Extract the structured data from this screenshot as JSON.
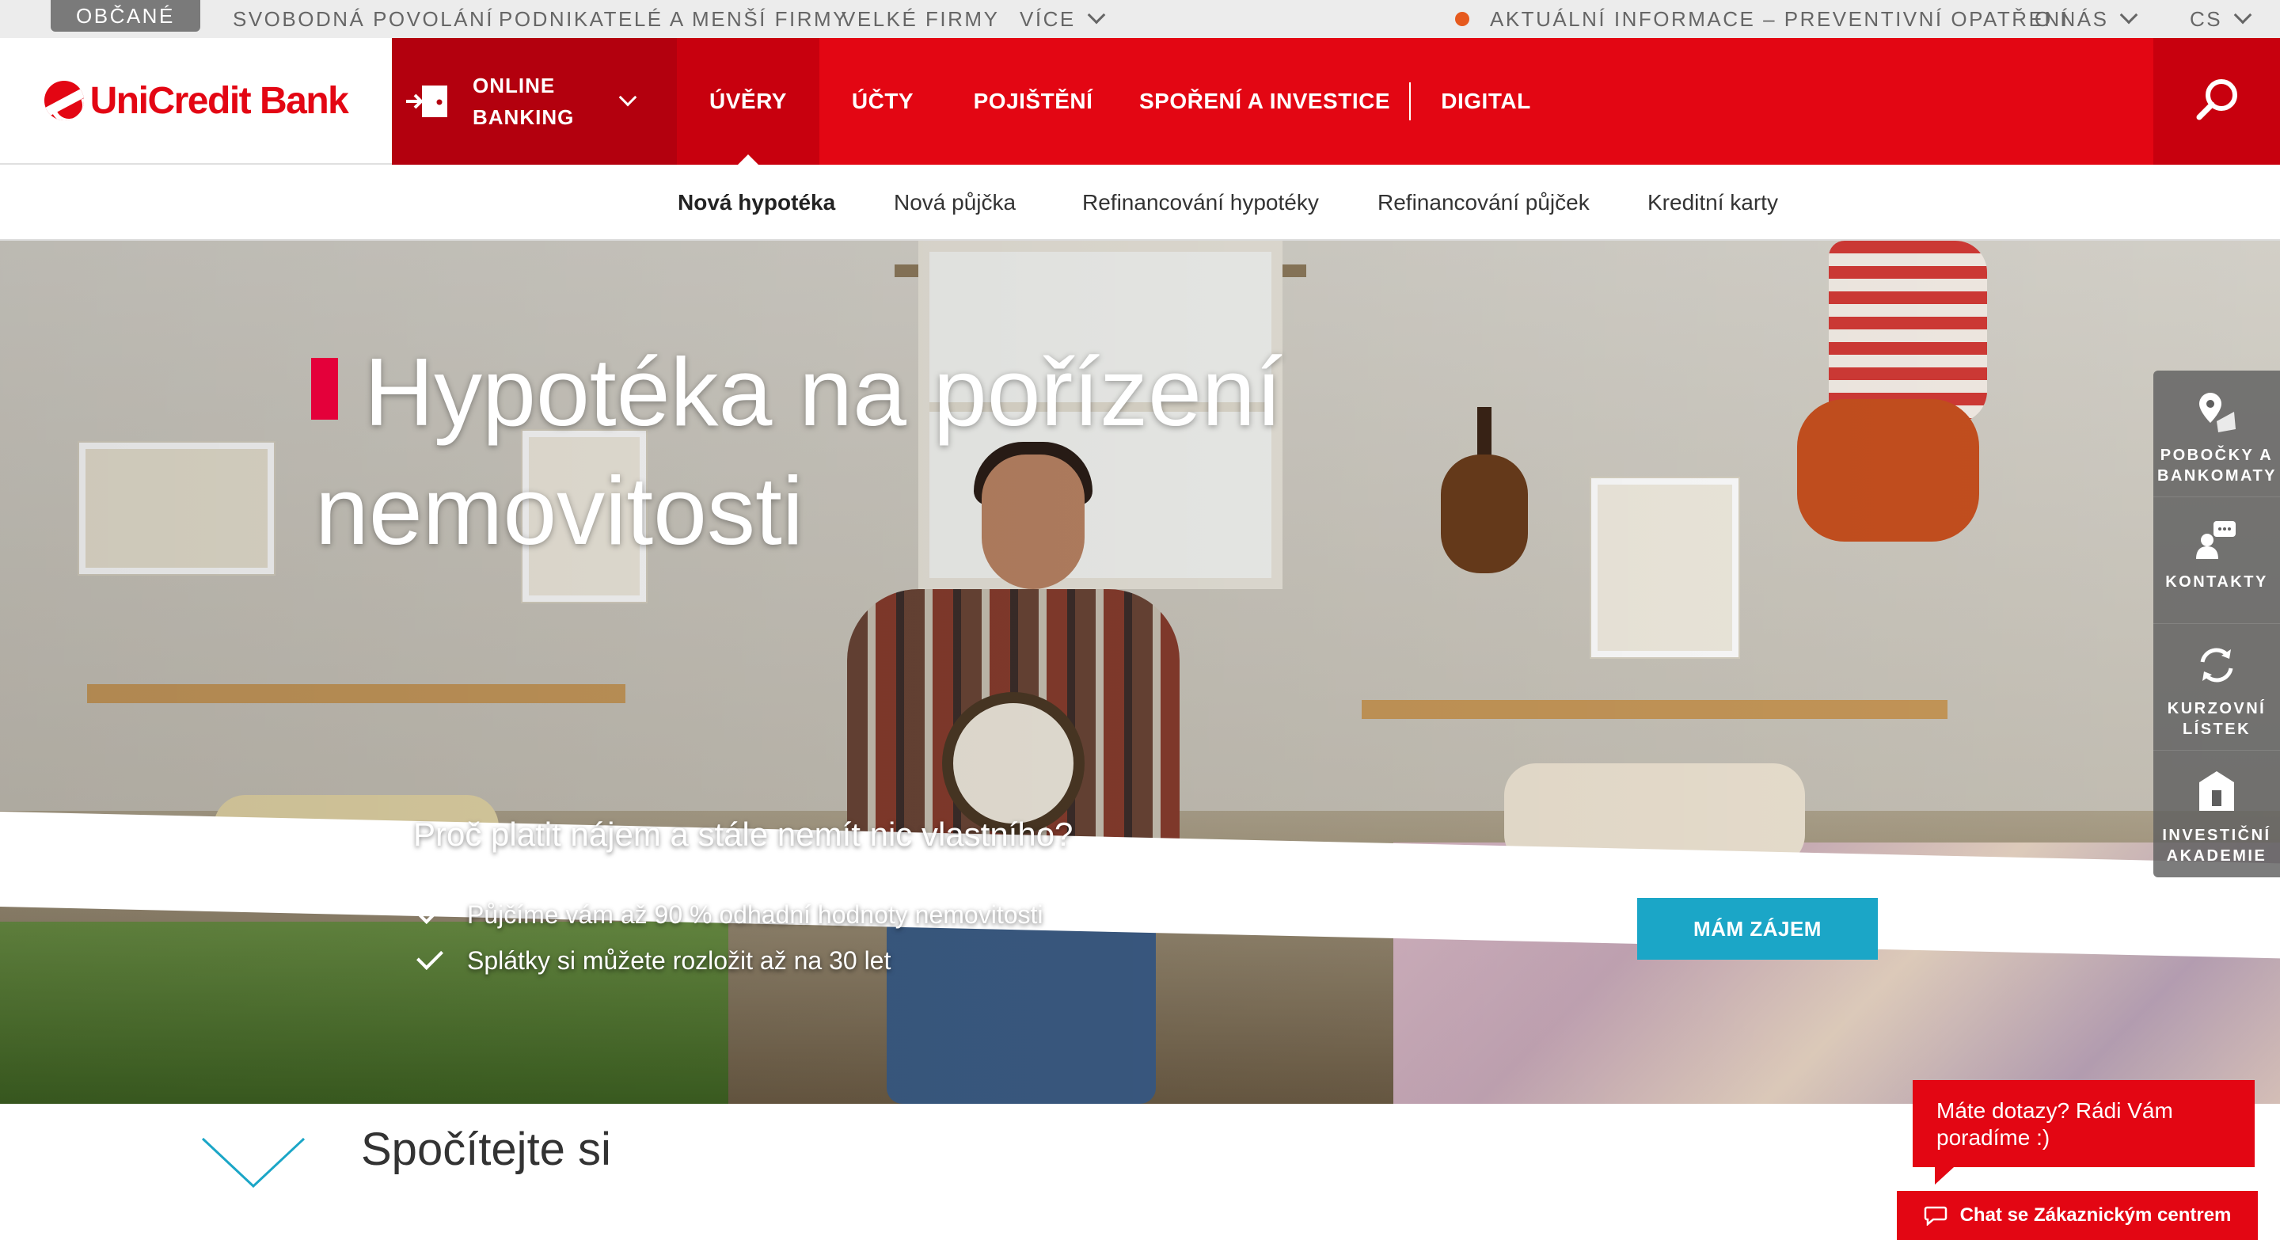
{
  "topbar": {
    "segments": [
      "OBČANÉ",
      "SVOBODNÁ POVOLÁNÍ",
      "PODNIKATELÉ A MENŠÍ FIRMY",
      "VELKÉ FIRMY",
      "VÍCE"
    ],
    "info": "AKTUÁLNÍ INFORMACE – PREVENTIVNÍ OPATŘENÍ",
    "about": "O NÁS",
    "lang": "CS"
  },
  "logo": {
    "text": "UniCredit Bank"
  },
  "online_banking": {
    "line1": "ONLINE",
    "line2": "BANKING"
  },
  "nav": {
    "items": [
      "ÚVĚRY",
      "ÚČTY",
      "POJIŠTĚNÍ",
      "SPOŘENÍ A INVESTICE",
      "DIGITAL"
    ]
  },
  "subnav": {
    "items": [
      "Nová hypotéka",
      "Nová půjčka",
      "Refinancování hypotéky",
      "Refinancování půjček",
      "Kreditní karty"
    ]
  },
  "hero": {
    "title": "Hypotéka na pořízení nemovitosti",
    "subtitle": "Proč platit nájem a stále nemít nic vlastního?",
    "bullets": [
      "Půjčíme vám až 90 % odhadní hodnoty nemovitosti",
      "Splátky si můžete rozložit až na 30 let"
    ],
    "cta": "MÁM ZÁJEM"
  },
  "sidebar": {
    "items": [
      {
        "label": "POBOČKY A BANKOMATY",
        "icon": "map-pin-icon"
      },
      {
        "label": "KONTAKTY",
        "icon": "contacts-icon"
      },
      {
        "label": "KURZOVNÍ LÍSTEK",
        "icon": "exchange-icon"
      },
      {
        "label": "INVESTIČNÍ AKADEMIE",
        "icon": "academy-icon"
      }
    ]
  },
  "section": {
    "title": "Spočítejte si"
  },
  "chat": {
    "bubble": "Máte dotazy? Rádi Vám poradíme :)",
    "button": "Chat se Zákaznickým centrem"
  },
  "colors": {
    "brand_red": "#e30613",
    "nav_dark_red": "#b3000e",
    "cta_blue": "#1ba6c7",
    "accent_pink": "#e4003a",
    "info_dot": "#e65a1e"
  }
}
